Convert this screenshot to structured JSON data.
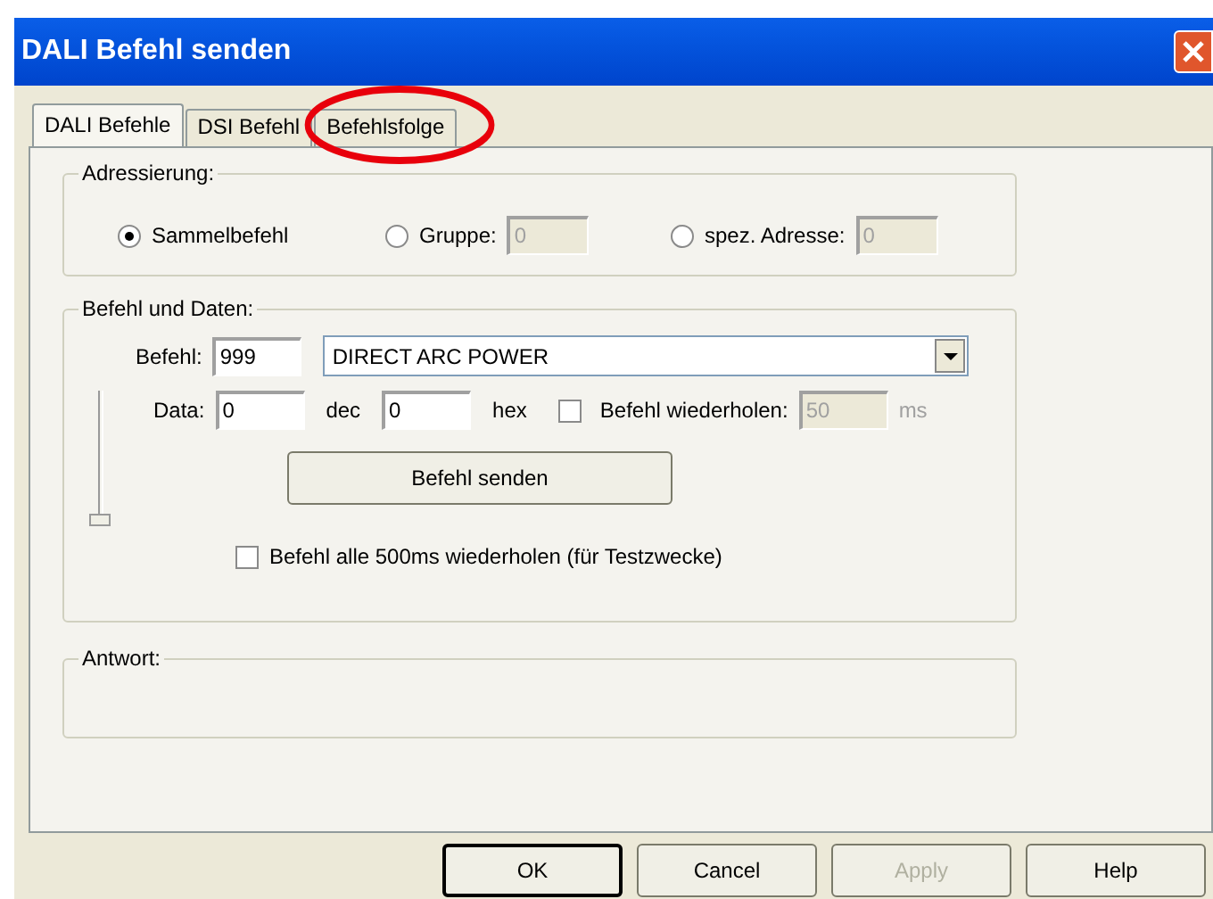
{
  "window": {
    "title": "DALI Befehl senden"
  },
  "tabs": [
    {
      "label": "DALI Befehle",
      "selected": true
    },
    {
      "label": "DSI Befehl",
      "selected": false
    },
    {
      "label": "Befehlsfolge",
      "selected": false,
      "highlighted": true
    }
  ],
  "addressing": {
    "title": "Adressierung:",
    "options": [
      {
        "label": "Sammelbefehl",
        "selected": true
      },
      {
        "label": "Gruppe:",
        "selected": false,
        "value": "0"
      },
      {
        "label": "spez. Adresse:",
        "selected": false,
        "value": "0"
      }
    ]
  },
  "command": {
    "title": "Befehl und Daten:",
    "command_label": "Befehl:",
    "command_value": "999",
    "command_dropdown": "DIRECT ARC POWER",
    "data_label": "Data:",
    "dec_value": "0",
    "dec_label": "dec",
    "hex_value": "0",
    "hex_label": "hex",
    "repeat": {
      "label": "Befehl wiederholen:",
      "checked": false,
      "value": "50",
      "unit": "ms",
      "disabled": true
    },
    "slider": {
      "level": 0
    },
    "send_button": "Befehl senden",
    "test_repeat": {
      "label": "Befehl alle 500ms wiederholen (für Testzwecke)",
      "checked": false
    }
  },
  "response": {
    "title": "Antwort:"
  },
  "buttons": [
    {
      "label": "OK",
      "disabled": false,
      "default": true
    },
    {
      "label": "Cancel",
      "disabled": false,
      "default": false
    },
    {
      "label": "Apply",
      "disabled": true,
      "default": false
    },
    {
      "label": "Help",
      "disabled": false,
      "default": false
    }
  ]
}
